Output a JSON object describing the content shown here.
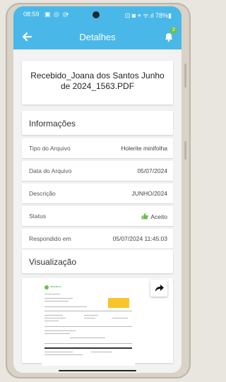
{
  "status_bar": {
    "time": "08:59",
    "left_icons": "▣ ◎ ◎",
    "dot": "•",
    "right_icons": "⊡ ◙ ⌖ ᯤ.ıl 78%▮"
  },
  "app_bar": {
    "title": "Detalhes",
    "notification_count": "2"
  },
  "file": {
    "name": "Recebido_Joana dos Santos Junho de 2024_1563.PDF"
  },
  "info": {
    "heading": "Informações",
    "rows": [
      {
        "label": "Tipo do Arquivo",
        "value": "Holerite minifolha"
      },
      {
        "label": "Data do Arquivo",
        "value": "05/07/2024"
      },
      {
        "label": "Descrição",
        "value": "JUNHO/2024"
      },
      {
        "label": "Status",
        "value": "Aceito"
      },
      {
        "label": "Respondido em",
        "value": "05/07/2024 11:45:03"
      }
    ]
  },
  "preview": {
    "heading": "Visualização",
    "doc_logo": "secullum"
  },
  "colors": {
    "primary": "#49b8e8",
    "accent_green": "#6cc04a",
    "doc_highlight": "#f8c42a"
  },
  "icons": {
    "back": "arrow-left-icon",
    "notifications": "bell-icon",
    "status_ok": "thumbs-up-icon",
    "share": "share-icon"
  }
}
